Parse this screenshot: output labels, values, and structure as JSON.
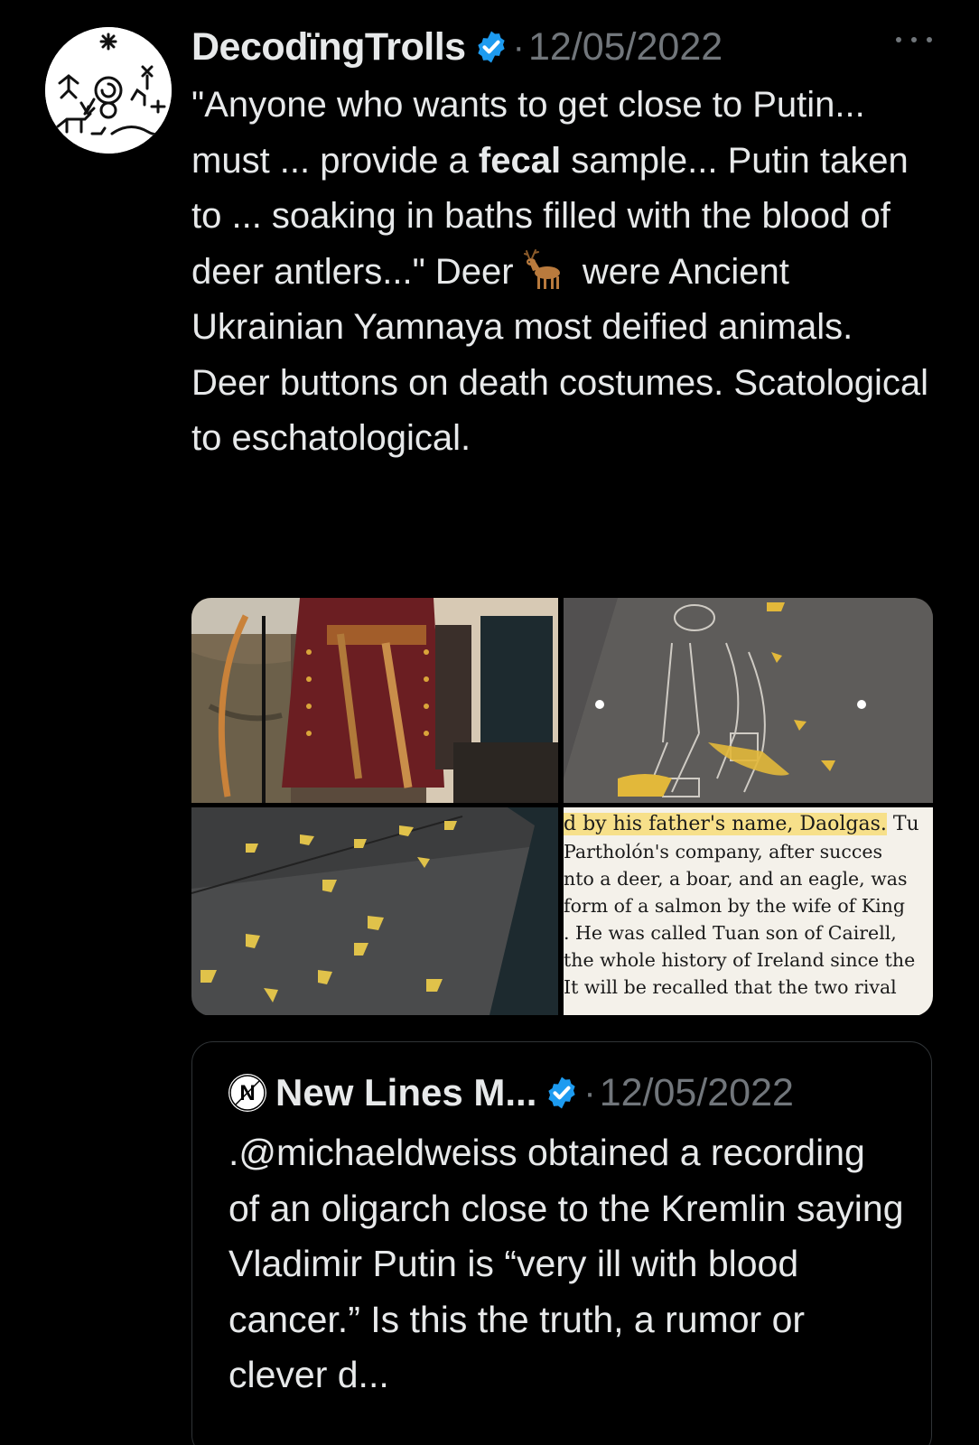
{
  "tweet": {
    "author_name": "DecodïngTrolls",
    "separator": "·",
    "date": "12/05/2022",
    "more_label": "More",
    "text_segments": {
      "s1": "\"Anyone who wants to get close to Putin... must ... provide a ",
      "bold": "fecal",
      "s2": " sample... Putin taken to ... soaking in baths filled with the blood of deer antlers...\" Deer ",
      "s3": " were Ancient Ukrainian Yamnaya most deified animals. Deer buttons on death costumes. Scatological to eschatological."
    },
    "emoji": "deer-emoji",
    "verified_color": "#1d9bf0"
  },
  "media": {
    "book_lines": {
      "l1_highlight": "d by his father's name, Daolgas.",
      "l1_rest": " Tu",
      "l2": "   Partholón's  company,  after  succes",
      "l3": "nto a deer, a boar, and an eagle, was",
      "l4": "form of a salmon by the wife of King",
      "l5": ". He was called Tuan son of Cairell,",
      "l6": "the whole history of Ireland since the",
      "l7": "  It will be recalled that the two rival"
    }
  },
  "quote": {
    "author_name": "New Lines M...",
    "separator": "·",
    "date": "12/05/2022",
    "avatar_letter": "N",
    "text": ".@michaeldweiss obtained a recording of an oligarch close to the Kremlin saying Vladimir Putin is “very ill with blood cancer.” Is this the truth, a rumor or clever d..."
  },
  "colors": {
    "background": "#000000",
    "text": "#e7e9ea",
    "secondary": "#71767b",
    "border": "#2f3336",
    "verified": "#1d9bf0"
  }
}
